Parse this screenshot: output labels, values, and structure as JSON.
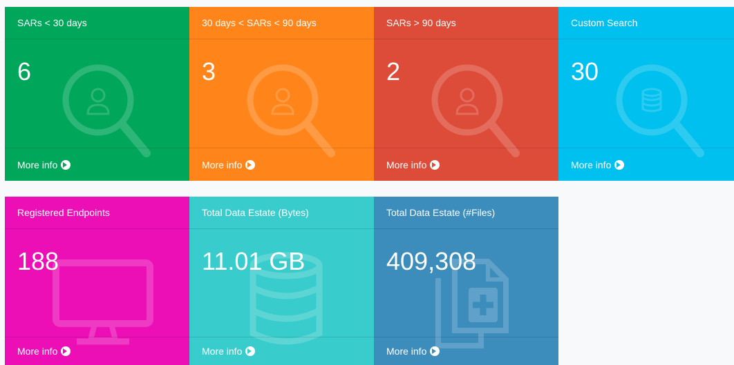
{
  "row1": [
    {
      "title": "SARs < 30 days",
      "value": "6",
      "footer": "More info",
      "color": "#00a65a",
      "icon": "search-user-icon"
    },
    {
      "title": "30 days < SARs < 90 days",
      "value": "3",
      "footer": "More info",
      "color": "#ff851b",
      "icon": "search-user-icon"
    },
    {
      "title": "SARs > 90 days",
      "value": "2",
      "footer": "More info",
      "color": "#dd4b39",
      "icon": "search-user-icon"
    },
    {
      "title": "Custom Search",
      "value": "30",
      "footer": "More info",
      "color": "#00c0ef",
      "icon": "search-database-icon"
    }
  ],
  "row2": [
    {
      "title": "Registered Endpoints",
      "value": "188",
      "footer": "More info",
      "color": "#ec0fb6",
      "icon": "desktop-icon"
    },
    {
      "title": "Total Data Estate (Bytes)",
      "value": "11.01 GB",
      "footer": "More info",
      "color": "#39cccc",
      "icon": "database-icon"
    },
    {
      "title": "Total Data Estate (#Files)",
      "value": "409,308",
      "footer": "More info",
      "color": "#3c8dbc",
      "icon": "file-copy-icon"
    }
  ]
}
